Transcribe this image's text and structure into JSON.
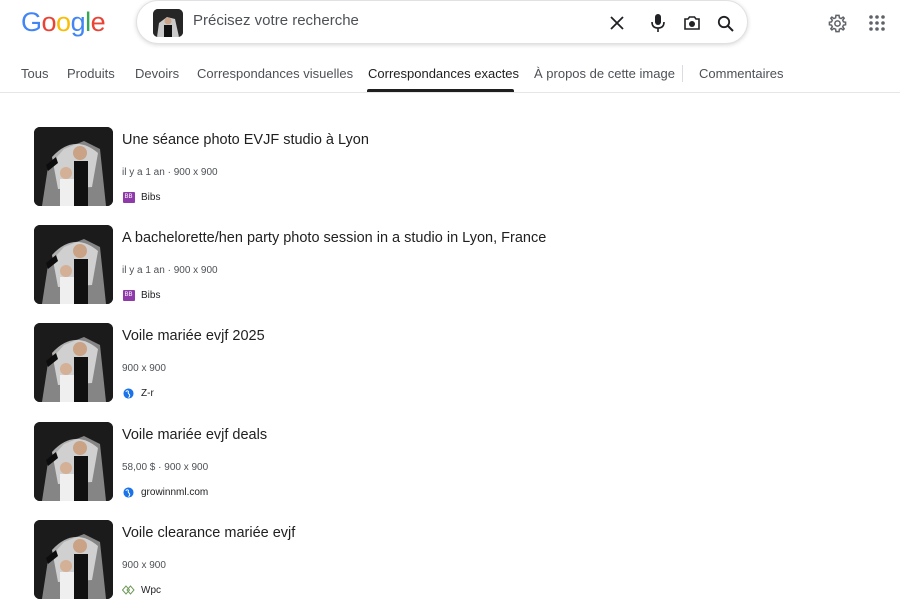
{
  "logo": {
    "letters": [
      "G",
      "o",
      "o",
      "g",
      "l",
      "e"
    ]
  },
  "search": {
    "placeholder": "Précisez votre recherche",
    "value": ""
  },
  "tabs": [
    {
      "label": "Tous"
    },
    {
      "label": "Produits"
    },
    {
      "label": "Devoirs"
    },
    {
      "label": "Correspondances visuelles"
    },
    {
      "label": "Correspondances exactes"
    },
    {
      "label": "À propos de cette image"
    },
    {
      "label": "Commentaires"
    }
  ],
  "active_tab": "Correspondances exactes",
  "results": [
    {
      "title": "Une séance photo EVJF studio à Lyon",
      "meta": "il y a 1 an · 900 x 900",
      "source": "Bibs",
      "source_icon": "bibs-logo-icon"
    },
    {
      "title": "A bachelorette/hen party photo session in a studio in Lyon, France",
      "meta": "il y a 1 an · 900 x 900",
      "source": "Bibs",
      "source_icon": "bibs-logo-icon"
    },
    {
      "title": "Voile mariée evjf 2025",
      "meta": "900 x 900",
      "source": "Z-r",
      "source_icon": "globe-icon"
    },
    {
      "title": "Voile mariée evjf deals",
      "meta": "58,00 $ · 900 x 900",
      "source": "growinnml.com",
      "source_icon": "globe-icon"
    },
    {
      "title": "Voile clearance mariée evjf",
      "meta": "900 x 900",
      "source": "Wpc",
      "source_icon": "wpc-logo-icon"
    }
  ],
  "colors": {
    "blue": "#4285F4",
    "red": "#EA4335",
    "yellow": "#FBBC05",
    "green": "#34A853",
    "bibs": "#8e3aa9"
  }
}
